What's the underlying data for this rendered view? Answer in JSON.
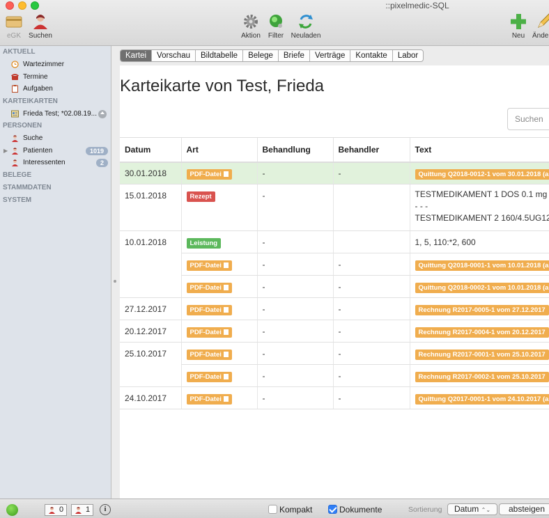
{
  "window": {
    "title": "::pixelmedic-SQL"
  },
  "toolbar": {
    "egk": "eGK",
    "suchen": "Suchen",
    "aktion": "Aktion",
    "filter": "Filter",
    "neuladen": "Neuladen",
    "neu": "Neu",
    "aendern": "Ände"
  },
  "sidebar": {
    "aktuell": "AKTUELL",
    "wartezimmer": "Wartezimmer",
    "termine": "Termine",
    "aufgaben": "Aufgaben",
    "karteikarten": "KARTEIKARTEN",
    "frieda": "Frieda Test; *02.08.19...",
    "personen": "PERSONEN",
    "suche": "Suche",
    "patienten": "Patienten",
    "patienten_count": "1019",
    "interessenten": "Interessenten",
    "interessenten_count": "2",
    "belege": "BELEGE",
    "stammdaten": "STAMMDATEN",
    "system": "SYSTEM"
  },
  "tabs": [
    "Kartei",
    "Vorschau",
    "Bildtabelle",
    "Belege",
    "Briefe",
    "Verträge",
    "Kontakte",
    "Labor"
  ],
  "page": {
    "title": "Karteikarte von Test, Frieda",
    "search_placeholder": "Suchen"
  },
  "table": {
    "headers": [
      "Datum",
      "Art",
      "Behandlung",
      "Behandler",
      "Text"
    ],
    "rows": [
      {
        "datum": "30.01.2018",
        "art": "PDF-Datei",
        "behandlung": "-",
        "behandler": "-",
        "text": "Quittung Q2018-0012-1 vom 30.01.2018 (a"
      },
      {
        "datum": "15.01.2018",
        "art": "Rezept",
        "behandlung": "-",
        "behandler": "",
        "text1": "TESTMEDIKAMENT 1 DOS 0.1 mg",
        "text2": "- - -",
        "text3": "TESTMEDIKAMENT 2 160/4.5UG12"
      },
      {
        "datum": "10.01.2018",
        "art": "Leistung",
        "behandlung": "-",
        "behandler": "",
        "text": "1, 5, 110:*2, 600"
      },
      {
        "datum": "",
        "art": "PDF-Datei",
        "behandlung": "-",
        "behandler": "-",
        "text": "Quittung Q2018-0001-1 vom 10.01.2018 (a"
      },
      {
        "datum": "",
        "art": "PDF-Datei",
        "behandlung": "-",
        "behandler": "-",
        "text": "Quittung Q2018-0002-1 vom 10.01.2018 (a"
      },
      {
        "datum": "27.12.2017",
        "art": "PDF-Datei",
        "behandlung": "-",
        "behandler": "-",
        "text": "Rechnung R2017-0005-1 vom 27.12.2017"
      },
      {
        "datum": "20.12.2017",
        "art": "PDF-Datei",
        "behandlung": "-",
        "behandler": "-",
        "text": "Rechnung R2017-0004-1 vom 20.12.2017"
      },
      {
        "datum": "25.10.2017",
        "art": "PDF-Datei",
        "behandlung": "-",
        "behandler": "-",
        "text": "Rechnung R2017-0001-1 vom 25.10.2017"
      },
      {
        "datum": "",
        "art": "PDF-Datei",
        "behandlung": "-",
        "behandler": "-",
        "text": "Rechnung R2017-0002-1 vom 25.10.2017"
      },
      {
        "datum": "24.10.2017",
        "art": "PDF-Datei",
        "behandlung": "-",
        "behandler": "-",
        "text": "Quittung Q2017-0001-1 vom 24.10.2017 (a"
      }
    ]
  },
  "bottom": {
    "count_a": "0",
    "count_b": "1",
    "kompakt": "Kompakt",
    "dokumente": "Dokumente",
    "sortierung": "Sortierung",
    "sort_value": "Datum",
    "order_value": "absteigen"
  },
  "colors": {
    "pdf": "#f0ad4e",
    "rezept": "#d9534f",
    "leistung": "#5cb85c",
    "highlight_row": "#e1f2dc",
    "active_tab": "#6f6f6f"
  }
}
